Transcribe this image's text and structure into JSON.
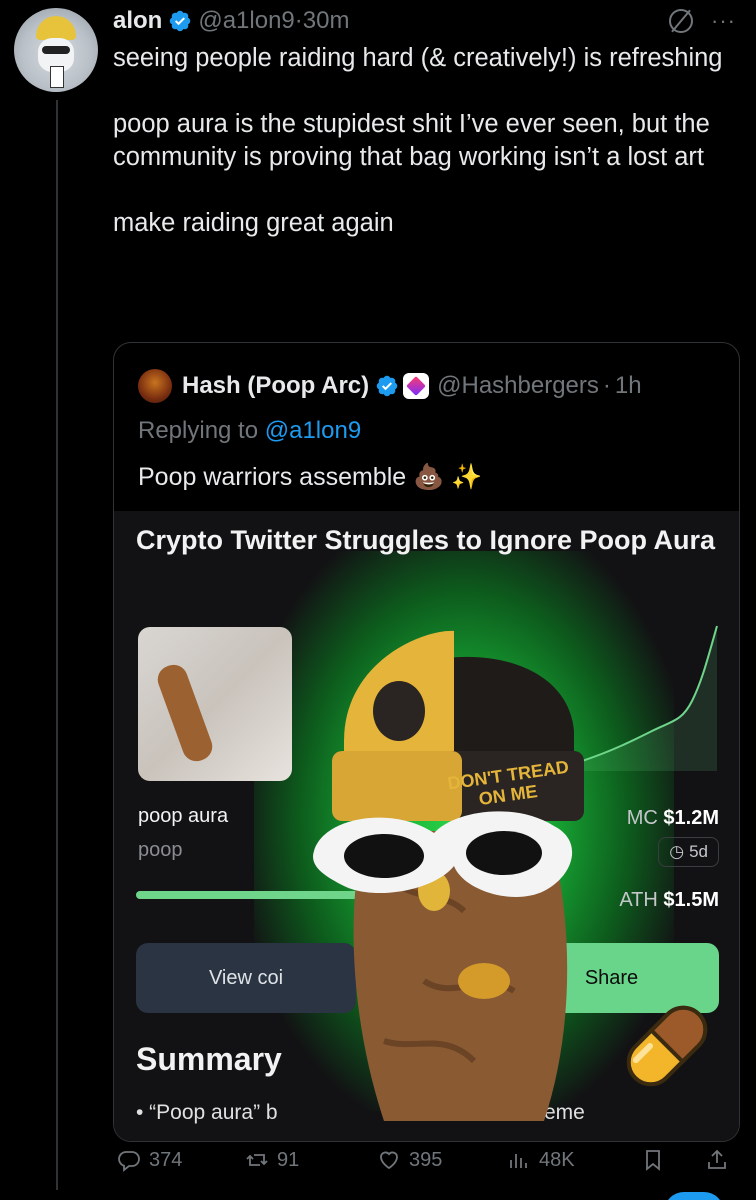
{
  "tweet": {
    "author_name": "alon",
    "handle": "@a1lon9",
    "separator": "·",
    "time": "30m",
    "text": "seeing people raiding hard (& creatively!) is refreshing\n\npoop aura is the stupidest shit I’ve ever seen, but the community is proving that bag working isn’t a lost art\n\nmake raiding great again",
    "verified_color": "#1d9bf0"
  },
  "quote": {
    "author_name": "Hash (Poop Arc)",
    "handle": "@Hashbergers",
    "separator": "·",
    "time": "1h",
    "replying_prefix": "Replying to",
    "replying_to": "@a1lon9",
    "text": "Poop warriors assemble 💩 ✨",
    "image": {
      "headline": "Crypto Twitter Struggles to Ignore Poop Aura",
      "coin_name": "poop aura",
      "coin_ticker": "poop",
      "mc_label": "MC",
      "mc_value": "$1.2M",
      "age": "5d",
      "ath_label": "ATH",
      "ath_value": "$1.5M",
      "progress": 0.8,
      "view_button": "View coi",
      "share_button": "Share",
      "summary_heading": "Summary",
      "bullet_text": "• “Poop aura” b",
      "bullet_tail": "eme",
      "hat_text_line1": "DON'T TREAD",
      "hat_text_line2": "ON ME"
    }
  },
  "actions": {
    "replies": "374",
    "retweets": "91",
    "likes": "395",
    "views": "48K"
  },
  "colors": {
    "background": "#000000",
    "text_primary": "#e7e9ea",
    "text_secondary": "#71767b",
    "accent": "#1d9bf0",
    "glow_green": "#2ad84a"
  }
}
